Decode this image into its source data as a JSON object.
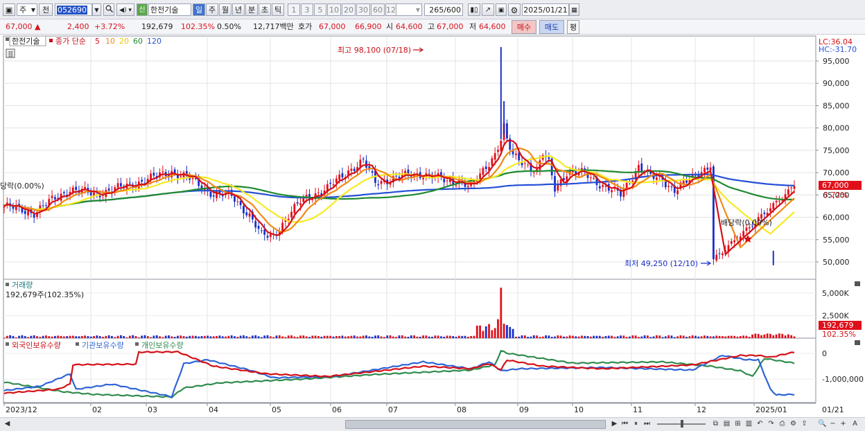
{
  "toolbar": {
    "market": "주",
    "scope": "전",
    "code": "052690",
    "new_badge": "신",
    "stock_name": "한전기술",
    "periods": [
      "일",
      "주",
      "월",
      "년",
      "분",
      "초",
      "틱"
    ],
    "minutes": [
      "1",
      "3",
      "5",
      "10",
      "20",
      "30",
      "60",
      "120"
    ],
    "count": "265",
    "count_max": "/600",
    "date": "2025/01/21"
  },
  "quote": {
    "price": "67,000",
    "change": "2,400",
    "change_pct": "+3.72%",
    "volume": "192,679",
    "volume_ratio": "102.35%",
    "turnover": "0.50%",
    "amount": "12,717백만",
    "ask_label": "호가",
    "ask1": "67,000",
    "ask2": "66,900",
    "open_label": "시",
    "open": "64,600",
    "high_label": "고",
    "high": "67,000",
    "low_label": "저",
    "low": "64,600",
    "buy_label": "매수",
    "sell_label": "매도",
    "eval_label": "평"
  },
  "price_panel": {
    "stock": "한전기술",
    "ma_label": "종가 단순",
    "ma_periods": [
      "5",
      "10",
      "20",
      "60",
      "120"
    ],
    "lc": "LC:36.04",
    "hc": "HC:-31.70",
    "current_price": "67,000",
    "current_pct": "3.72%",
    "high_annotation": "최고 98,100 (07/18)",
    "low_annotation": "최저 49,250 (12/10)",
    "div_annotation": "배당락(0.00%)",
    "div_annotation_left": "당락(0.00%)",
    "y_ticks": [
      "95,000",
      "90,000",
      "85,000",
      "80,000",
      "75,000",
      "70,000",
      "65,000",
      "60,000",
      "55,000",
      "50,000"
    ]
  },
  "volume_panel": {
    "title": "거래량",
    "summary": "192,679주(102.35%)",
    "y_ticks": [
      "5,000K",
      "2,500K"
    ],
    "current": "192,679",
    "current_pct": "102.35%"
  },
  "holdings_panel": {
    "foreign": "외국인보유수량",
    "institution": "기관보유수량",
    "individual": "개인보유수량",
    "y_ticks": [
      "0",
      "-1,000,000"
    ]
  },
  "x_axis": {
    "labels": [
      "2023/12",
      "02",
      "03",
      "04",
      "05",
      "06",
      "07",
      "08",
      "09",
      "10",
      "11",
      "12",
      "2025/01"
    ],
    "right_label": "01/21"
  },
  "colors": {
    "up": "#e0101b",
    "down": "#1a2fc9",
    "ma5": "#d41016",
    "ma10": "#f18a13",
    "ma20": "#f6ea1e",
    "ma60": "#1e8a2e",
    "ma120": "#2450d6",
    "foreign": "#d41016",
    "institution": "#2e64d8",
    "individual": "#2f8b4e"
  }
}
